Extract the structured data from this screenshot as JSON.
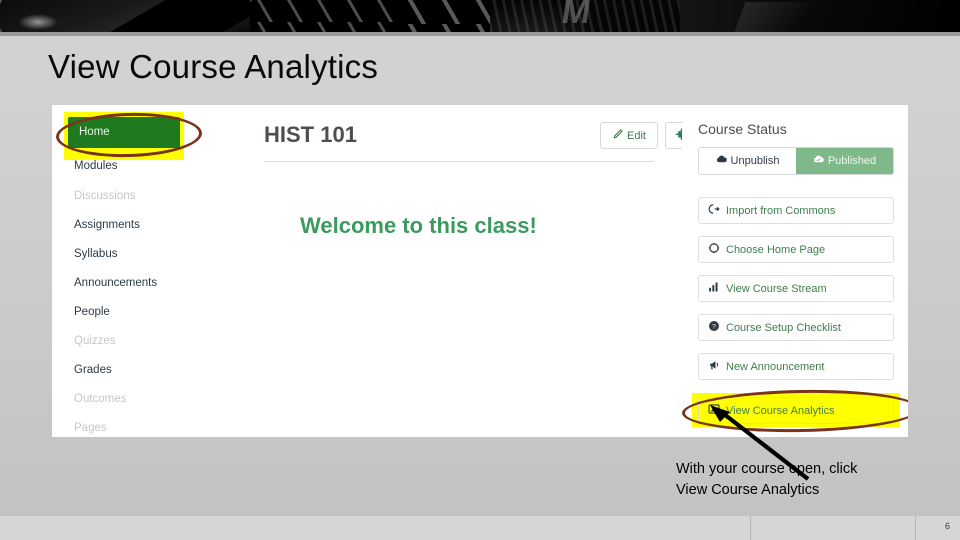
{
  "slide": {
    "title": "View Course Analytics",
    "page_number": "6",
    "banner_alt": "grayscale-automotive-banner"
  },
  "callout": {
    "text": "With your course open, click View Course Analytics",
    "line1": "With your course open, click",
    "line2": "View Course Analytics",
    "highlight_color": "#ffff00",
    "oval_color": "#7a3418",
    "arrow_color": "#000000"
  },
  "screenshot": {
    "course_nav": {
      "items": [
        {
          "label": "Home",
          "state": "active"
        },
        {
          "label": "Modules",
          "state": "normal"
        },
        {
          "label": "Discussions",
          "state": "dimmed"
        },
        {
          "label": "Assignments",
          "state": "normal"
        },
        {
          "label": "Syllabus",
          "state": "normal"
        },
        {
          "label": "Announcements",
          "state": "normal"
        },
        {
          "label": "People",
          "state": "normal"
        },
        {
          "label": "Quizzes",
          "state": "dimmed"
        },
        {
          "label": "Grades",
          "state": "normal"
        },
        {
          "label": "Outcomes",
          "state": "dimmed"
        },
        {
          "label": "Pages",
          "state": "dimmed"
        }
      ],
      "active_bg": "#1f7a1f"
    },
    "main": {
      "course_code": "HIST 101",
      "edit_label": "Edit",
      "edit_icon": "pencil-icon",
      "gear_icon": "gear-icon",
      "gear_caret": "▾",
      "welcome_heading": "Welcome to this class!",
      "welcome_color": "#3c9a5f"
    },
    "course_status": {
      "title": "Course Status",
      "unpublish_label": "Unpublish",
      "unpublish_icon": "cloud-unpublish-icon",
      "published_label": "Published",
      "published_icon": "cloud-check-icon",
      "published_bg": "#7fb98a",
      "buttons": [
        {
          "label": "Import from Commons",
          "icon": "import-arrow-icon"
        },
        {
          "label": "Choose Home Page",
          "icon": "target-icon"
        },
        {
          "label": "View Course Stream",
          "icon": "bar-chart-icon"
        },
        {
          "label": "Course Setup Checklist",
          "icon": "question-circle-icon"
        },
        {
          "label": "New Announcement",
          "icon": "megaphone-icon"
        },
        {
          "label": "View Course Analytics",
          "icon": "image-chart-icon",
          "highlighted": true
        }
      ]
    }
  }
}
